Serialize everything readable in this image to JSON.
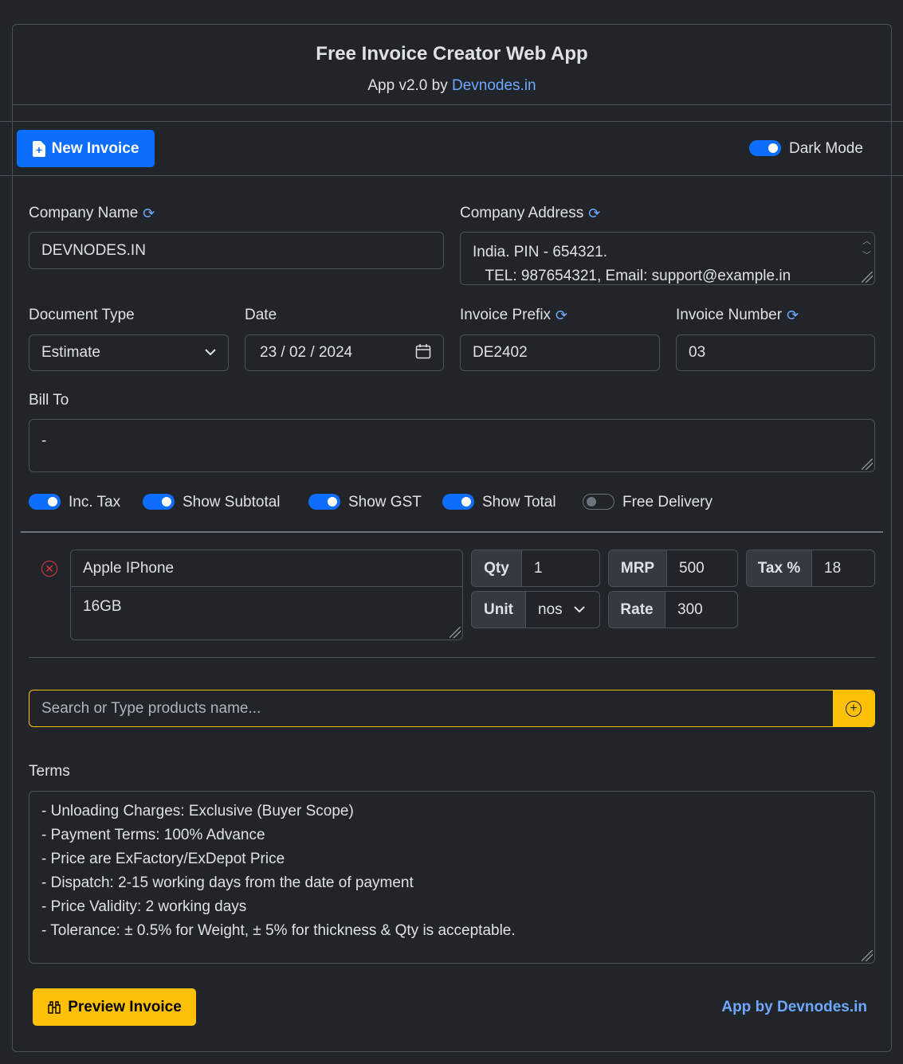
{
  "header": {
    "title": "Free Invoice Creator Web App",
    "subtitle_prefix": "App v2.0 by",
    "subtitle_link": "Devnodes.in"
  },
  "toolbar": {
    "new_invoice_label": "New Invoice",
    "dark_mode_label": "Dark Mode",
    "dark_mode_on": true
  },
  "form": {
    "company_name_label": "Company Name",
    "company_name_value": "DEVNODES.IN",
    "company_address_label": "Company Address",
    "company_address_value": "India. PIN - 654321.\n   TEL: 987654321, Email: support@example.in",
    "document_type_label": "Document Type",
    "document_type_value": "Estimate",
    "date_label": "Date",
    "date_value": "23 / 02 / 2024",
    "invoice_prefix_label": "Invoice Prefix",
    "invoice_prefix_value": "DE2402",
    "invoice_number_label": "Invoice Number",
    "invoice_number_value": "03",
    "bill_to_label": "Bill To",
    "bill_to_value": "-"
  },
  "toggles": [
    {
      "label": "Inc. Tax",
      "on": true
    },
    {
      "label": "Show Subtotal",
      "on": true
    },
    {
      "label": "Show GST",
      "on": true
    },
    {
      "label": "Show Total",
      "on": true
    },
    {
      "label": "Free Delivery",
      "on": false
    }
  ],
  "item": {
    "name": "Apple IPhone",
    "description": "16GB",
    "qty_label": "Qty",
    "qty_value": "1",
    "mrp_label": "MRP",
    "mrp_value": "500",
    "tax_label": "Tax %",
    "tax_value": "18",
    "unit_label": "Unit",
    "unit_value": "nos",
    "rate_label": "Rate",
    "rate_value": "300"
  },
  "search": {
    "placeholder": "Search or Type products name..."
  },
  "terms": {
    "label": "Terms",
    "value": "- Unloading Charges: Exclusive (Buyer Scope)\n- Payment Terms: 100% Advance\n- Price are ExFactory/ExDepot Price\n- Dispatch: 2-15 working days from the date of payment\n- Price Validity: 2 working days\n- Tolerance: ± 0.5% for Weight, ± 5% for thickness & Qty is acceptable."
  },
  "footer": {
    "preview_label": "Preview Invoice",
    "app_by_label": "App by Devnodes.in"
  },
  "colors": {
    "background": "#212529",
    "primary": "#0d6efd",
    "warning": "#ffc107",
    "link": "#6ea8fe",
    "danger": "#dc3545"
  }
}
